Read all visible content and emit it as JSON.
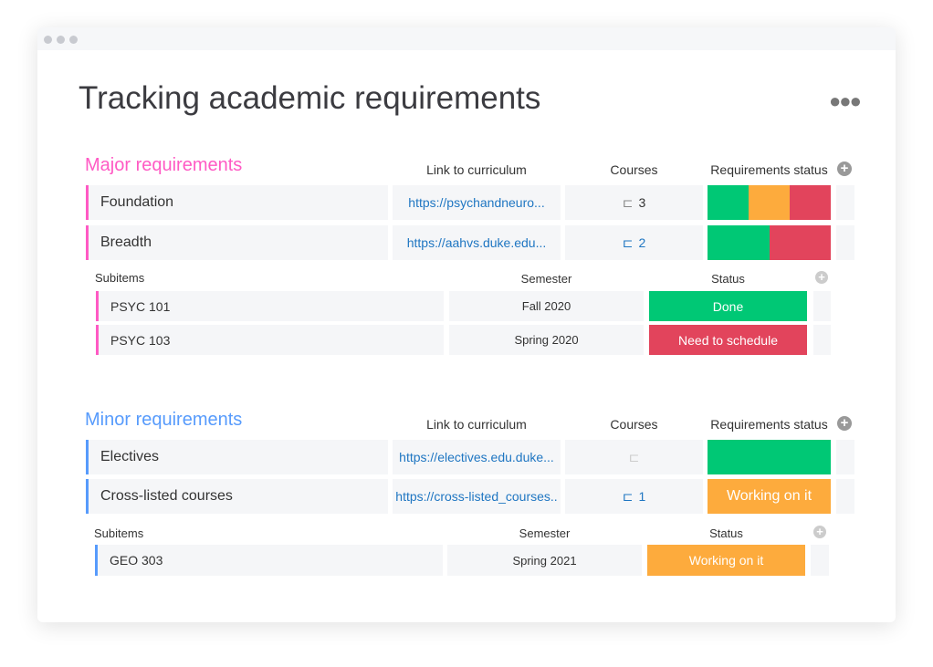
{
  "title": "Tracking academic requirements",
  "colors": {
    "major": "#ff5ac4",
    "minor": "#579bfc",
    "done": "#00c875",
    "working": "#fdab3d",
    "stuck": "#e2445c"
  },
  "columns": {
    "link": "Link to curriculum",
    "courses": "Courses",
    "status": "Requirements status",
    "subitems": "Subitems",
    "semester": "Semester",
    "sub_status": "Status"
  },
  "major": {
    "label": "Major requirements",
    "rows": [
      {
        "name": "Foundation",
        "link": "https://psychandneuro...",
        "courses": "3",
        "status_distribution": {
          "done": 0.33,
          "working": 0.34,
          "stuck": 0.33
        }
      },
      {
        "name": "Breadth",
        "link": "https://aahvs.duke.edu...",
        "courses": "2",
        "status_distribution": {
          "done": 0.5,
          "stuck": 0.5
        }
      }
    ],
    "subitems": [
      {
        "name": "PSYC 101",
        "semester": "Fall 2020",
        "status": "Done"
      },
      {
        "name": "PSYC 103",
        "semester": "Spring 2020",
        "status": "Need to schedule"
      }
    ]
  },
  "minor": {
    "label": "Minor requirements",
    "rows": [
      {
        "name": "Electives",
        "link": "https://electives.edu.duke...",
        "courses": "",
        "status_distribution": {
          "done": 1
        }
      },
      {
        "name": "Cross-listed courses",
        "link": "https://cross-listed_courses..",
        "courses": "1",
        "status": "Working on it"
      }
    ],
    "subitems": [
      {
        "name": "GEO 303",
        "semester": "Spring 2021",
        "status": "Working on it"
      }
    ]
  }
}
